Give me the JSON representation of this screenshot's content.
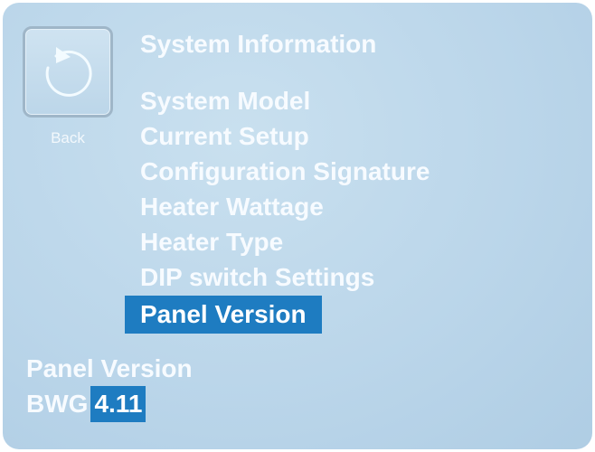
{
  "back": {
    "label": "Back",
    "icon": "undo-arrow-icon"
  },
  "title": "System Information",
  "menu": {
    "items": [
      {
        "label": "System Model"
      },
      {
        "label": "Current Setup"
      },
      {
        "label": "Configuration Signature"
      },
      {
        "label": "Heater Wattage"
      },
      {
        "label": "Heater Type"
      },
      {
        "label": "DIP switch Settings"
      },
      {
        "label": "Panel Version",
        "selected": true
      }
    ]
  },
  "detail": {
    "label": "Panel Version",
    "prefix": "BWG",
    "value": "4.11"
  },
  "colors": {
    "background": "#bbd6ea",
    "highlight": "#1e7cc1",
    "text": "#f7fbff",
    "icon_stroke": "#f3fbff"
  }
}
